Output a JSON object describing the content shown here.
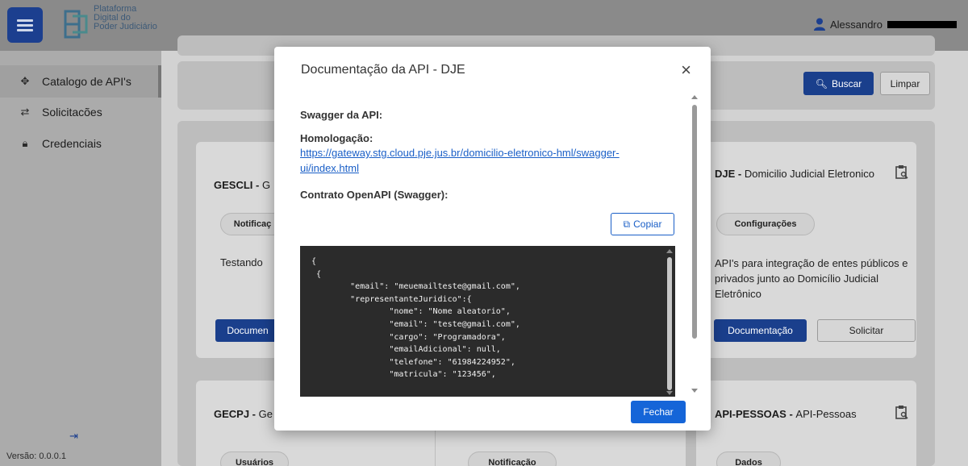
{
  "header": {
    "logo_line1": "Plataforma",
    "logo_line2": "Digital do",
    "logo_line3": "Poder Judiciário",
    "user_name": "Alessandro"
  },
  "sidebar": {
    "items": [
      {
        "label": "Catalogo de API's",
        "icon": "move-arrows-icon",
        "active": true
      },
      {
        "label": "Solicitacões",
        "icon": "compare-icon",
        "active": false
      },
      {
        "label": "Credenciais",
        "icon": "lock-icon",
        "active": false
      }
    ],
    "version": "Versão: 0.0.0.1"
  },
  "search": {
    "buscar_label": "Buscar",
    "limpar_label": "Limpar"
  },
  "cards": [
    {
      "code": "GESCLI - ",
      "name": "G",
      "chip": "Notificaç",
      "desc": "Testando",
      "doc_label": "Documen"
    },
    {
      "code": "DJE - ",
      "name": "Domicilio Judicial Eletronico",
      "chip": "Configurações",
      "desc": "API's para integração de entes públicos e privados junto ao Domicílio Judicial Eletrônico",
      "doc_label": "Documentação",
      "req_label": "Solicitar"
    },
    {
      "code": "GECPJ - ",
      "name": "Ge",
      "chip": "Usuários"
    },
    {
      "code": "",
      "name": "",
      "chip": "Notificação"
    },
    {
      "code": "API-PESSOAS - ",
      "name": "API-Pessoas",
      "chip": "Dados"
    }
  ],
  "modal": {
    "title": "Documentação da API - DJE",
    "swagger_label": "Swagger da API:",
    "homolog_label": "Homologação:",
    "homolog_url": "https://gateway.stg.cloud.pje.jus.br/domicilio-eletronico-hml/swagger-ui/index.html",
    "contract_label": "Contrato OpenAPI (Swagger):",
    "copy_label": "Copiar",
    "code": "{\n {\n        \"email\": \"meuemailteste@gmail.com\",\n        \"representanteJuridico\":{\n                \"nome\": \"Nome aleatorio\",\n                \"email\": \"teste@gmail.com\",\n                \"cargo\": \"Programadora\",\n                \"emailAdicional\": null,\n                \"telefone\": \"61984224952\",\n                \"matricula\": \"123456\",",
    "close_label": "Fechar"
  },
  "colors": {
    "primary": "#1565d8",
    "link": "#1a5fc7",
    "code_bg": "#2b2b2b"
  }
}
